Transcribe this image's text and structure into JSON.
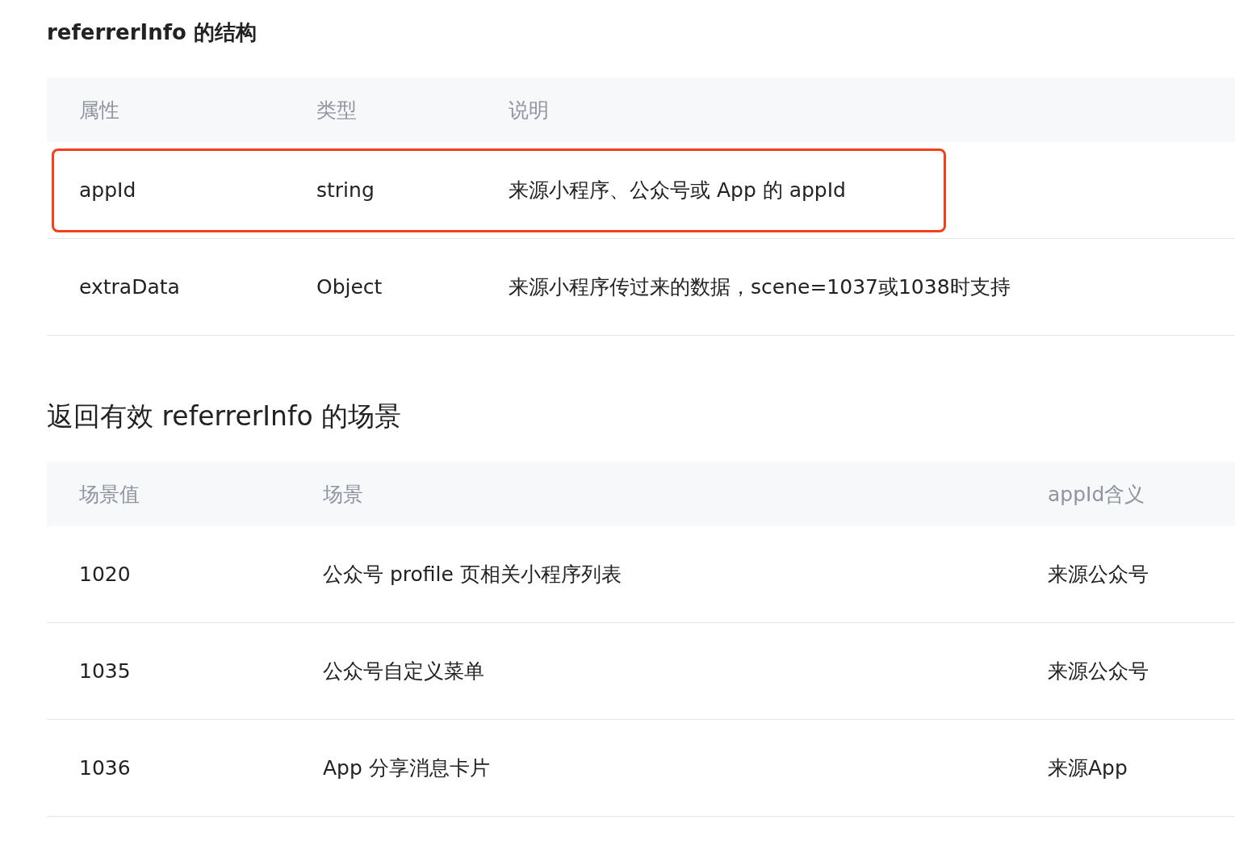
{
  "sections": [
    {
      "title": "referrerInfo 的结构",
      "columns": [
        "属性",
        "类型",
        "说明"
      ],
      "rows": [
        {
          "cells": [
            "appId",
            "string",
            "来源小程序、公众号或 App 的 appId"
          ],
          "highlighted": true
        },
        {
          "cells": [
            "extraData",
            "Object",
            "来源小程序传过来的数据，scene=1037或1038时支持"
          ],
          "highlighted": false
        }
      ]
    },
    {
      "title": "返回有效 referrerInfo 的场景",
      "columns": [
        "场景值",
        "场景",
        "appId含义"
      ],
      "rows": [
        {
          "cells": [
            "1020",
            "公众号 profile 页相关小程序列表",
            "来源公众号"
          ],
          "highlighted": false
        },
        {
          "cells": [
            "1035",
            "公众号自定义菜单",
            "来源公众号"
          ],
          "highlighted": false
        },
        {
          "cells": [
            "1036",
            "App 分享消息卡片",
            "来源App"
          ],
          "highlighted": false
        }
      ]
    }
  ]
}
